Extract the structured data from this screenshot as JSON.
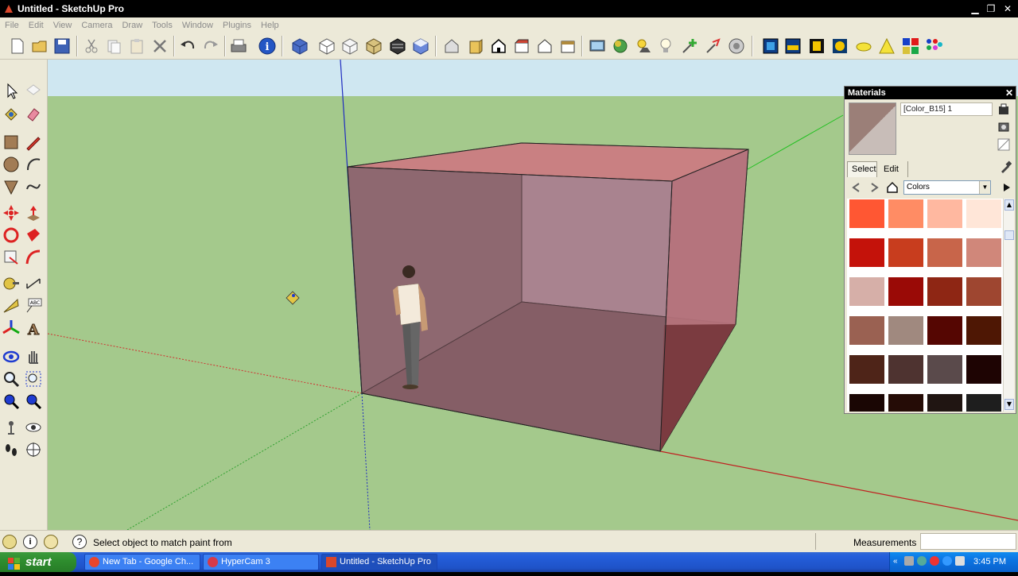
{
  "window": {
    "title": "Untitled - SketchUp Pro"
  },
  "menu": [
    "File",
    "Edit",
    "View",
    "Camera",
    "Draw",
    "Tools",
    "Window",
    "Plugins",
    "Help"
  ],
  "materials": {
    "panel_title": "Materials",
    "material_name": "[Color_B15] 1",
    "tabs": [
      "Select",
      "Edit"
    ],
    "collection": "Colors",
    "swatch_colors": [
      "#ff5733",
      "#ff8c64",
      "#ffb8a0",
      "#ffe6d8",
      "#c4120a",
      "#c83d1e",
      "#c8654a",
      "#d0877a",
      "#d6afa8",
      "#9a0a06",
      "#8e2614",
      "#9e4630",
      "#9a6152",
      "#a0897f",
      "#550602",
      "#4e1704",
      "#4e2418",
      "#4e3330",
      "#5a4a4b",
      "#1e0403",
      "#1a0604",
      "#250c06",
      "#201512",
      "#1e1e1e"
    ]
  },
  "status": {
    "message": "Select object to match paint from",
    "measurements_label": "Measurements",
    "measurements_value": ""
  },
  "taskbar": {
    "start_label": "start",
    "tasks": [
      "New Tab - Google Ch...",
      "HyperCam 3",
      "Untitled - SketchUp Pro"
    ],
    "clock": "3:45 PM"
  },
  "colors": {
    "sky": "#cfe7f1",
    "ground": "#a4c98c",
    "box_face": "#8e5d66",
    "axis_red": "#d02020",
    "axis_green": "#20b020",
    "axis_blue": "#2020c0"
  }
}
